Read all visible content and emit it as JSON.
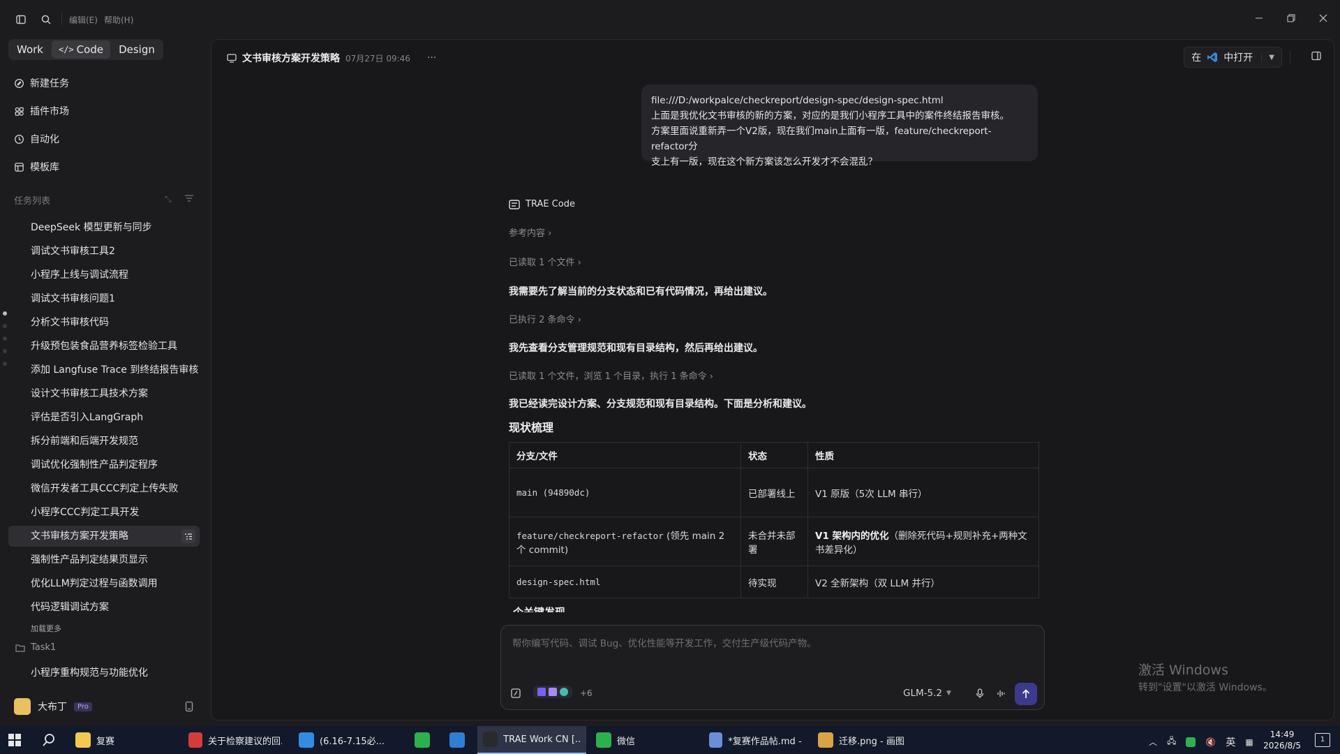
{
  "titlebar": {
    "menu_edit": "编辑(E)",
    "menu_help": "帮助(H)"
  },
  "sidebar": {
    "modes": [
      "Work",
      "Code",
      "Design"
    ],
    "active_mode": "Code",
    "nav": [
      {
        "label": "新建任务",
        "icon": "new-task-icon"
      },
      {
        "label": "插件市场",
        "icon": "plugin-market-icon"
      },
      {
        "label": "自动化",
        "icon": "clock-icon"
      },
      {
        "label": "模板库",
        "icon": "template-icon"
      }
    ],
    "section_label": "任务列表",
    "tasks": [
      "DeepSeek 模型更新与同步",
      "调试文书审核工具2",
      "小程序上线与调试流程",
      "调试文书审核问题1",
      "分析文书审核代码",
      "升级预包装食品营养标签检验工具",
      "添加 Langfuse Trace 到终结报告审核",
      "设计文书审核工具技术方案",
      "评估是否引入LangGraph",
      "拆分前端和后端开发规范",
      "调试优化强制性产品判定程序",
      "微信开发者工具CCC判定上传失败",
      "小程序CCC判定工具开发",
      "文书审核方案开发策略",
      "强制性产品判定结果页显示",
      "优化LLM判定过程与函数调用",
      "代码逻辑调试方案"
    ],
    "active_task_index": 13,
    "load_more": "加载更多",
    "folder": "Task1",
    "folder_task": "小程序重构规范与功能优化",
    "user": {
      "name": "大布丁",
      "badge": "Pro"
    }
  },
  "chat": {
    "title": "文书审核方案开发策略",
    "date": "07月27日 09:46",
    "open_in_prefix": "在",
    "open_in_suffix": "中打开",
    "user_message": [
      "file:///D:/workpalce/checkreport/design-spec/design-spec.html",
      "上面是我优化文书审核的新的方案，对应的是我们小程序工具中的案件终结报告审核。",
      "方案里面说重新弄一个V2版，现在我们main上面有一版，feature/checkreport-refactor分",
      "支上有一版，现在这个新方案该怎么开发才不会混乱？"
    ],
    "bot_name": "TRAE Code",
    "ref": "参考内容",
    "read1": "已读取 1 个文件",
    "p1": "我需要先了解当前的分支状态和已有代码情况，再给出建议。",
    "exec": "已执行 2 条命令",
    "p2": "我先查看分支管理规范和现有目录结构，然后再给出建议。",
    "read2": "已读取 1 个文件，浏览 1 个目录，执行 1 条命令",
    "p3": "我已经读完设计方案、分支规范和现有目录结构。下面是分析和建议。",
    "h_status": "现状梳理",
    "table": {
      "headers": [
        "分支/文件",
        "状态",
        "性质"
      ],
      "rows": [
        {
          "code": "main",
          "extra": " (94890dc)",
          "status": "已部署线上",
          "nature_bold": "",
          "nature": "V1 原版（5次 LLM 串行）"
        },
        {
          "code": "feature/checkreport-refactor",
          "extra": " (领先 main 2 个 commit)",
          "status": "未合并未部署",
          "nature_bold": "V1 架构内的优化",
          "nature": "（删除死代码+规则补充+两种文书差异化）"
        },
        {
          "code": "design-spec.html",
          "extra": "",
          "status": "待实现",
          "nature_bold": "",
          "nature": "V2 全新架构（双 LLM 并行）"
        }
      ]
    },
    "h_cut": "个关键发现",
    "input_placeholder": "帮你编写代码、调试 Bug、优化性能等开发工作，交付生产级代码产物。",
    "attachments_more": "+6",
    "model": "GLM-5.2"
  },
  "watermark": {
    "line1": "激活 Windows",
    "line2": "转到\"设置\"以激活 Windows。"
  },
  "taskbar": {
    "items": [
      {
        "label": "复赛",
        "color": "#f2c94c"
      },
      {
        "label": "关于检察建议的回...",
        "color": "#d63b3b"
      },
      {
        "label": "(6.16-7.15必...",
        "color": "#2f8de4"
      },
      {
        "label": "",
        "color": "#2bb24c"
      },
      {
        "label": "",
        "color": "#2f7fd6"
      },
      {
        "label": "TRAE Work CN [...",
        "color": "#2a2a2e"
      },
      {
        "label": "微信",
        "color": "#2bb24c"
      },
      {
        "label": "*复赛作品帖.md - ...",
        "color": "#6a8fd8"
      },
      {
        "label": "迁移.png - 画图",
        "color": "#d9a441"
      }
    ],
    "ime": "英",
    "time": "14:49",
    "date": "2026/8/5",
    "notify_count": "1"
  }
}
